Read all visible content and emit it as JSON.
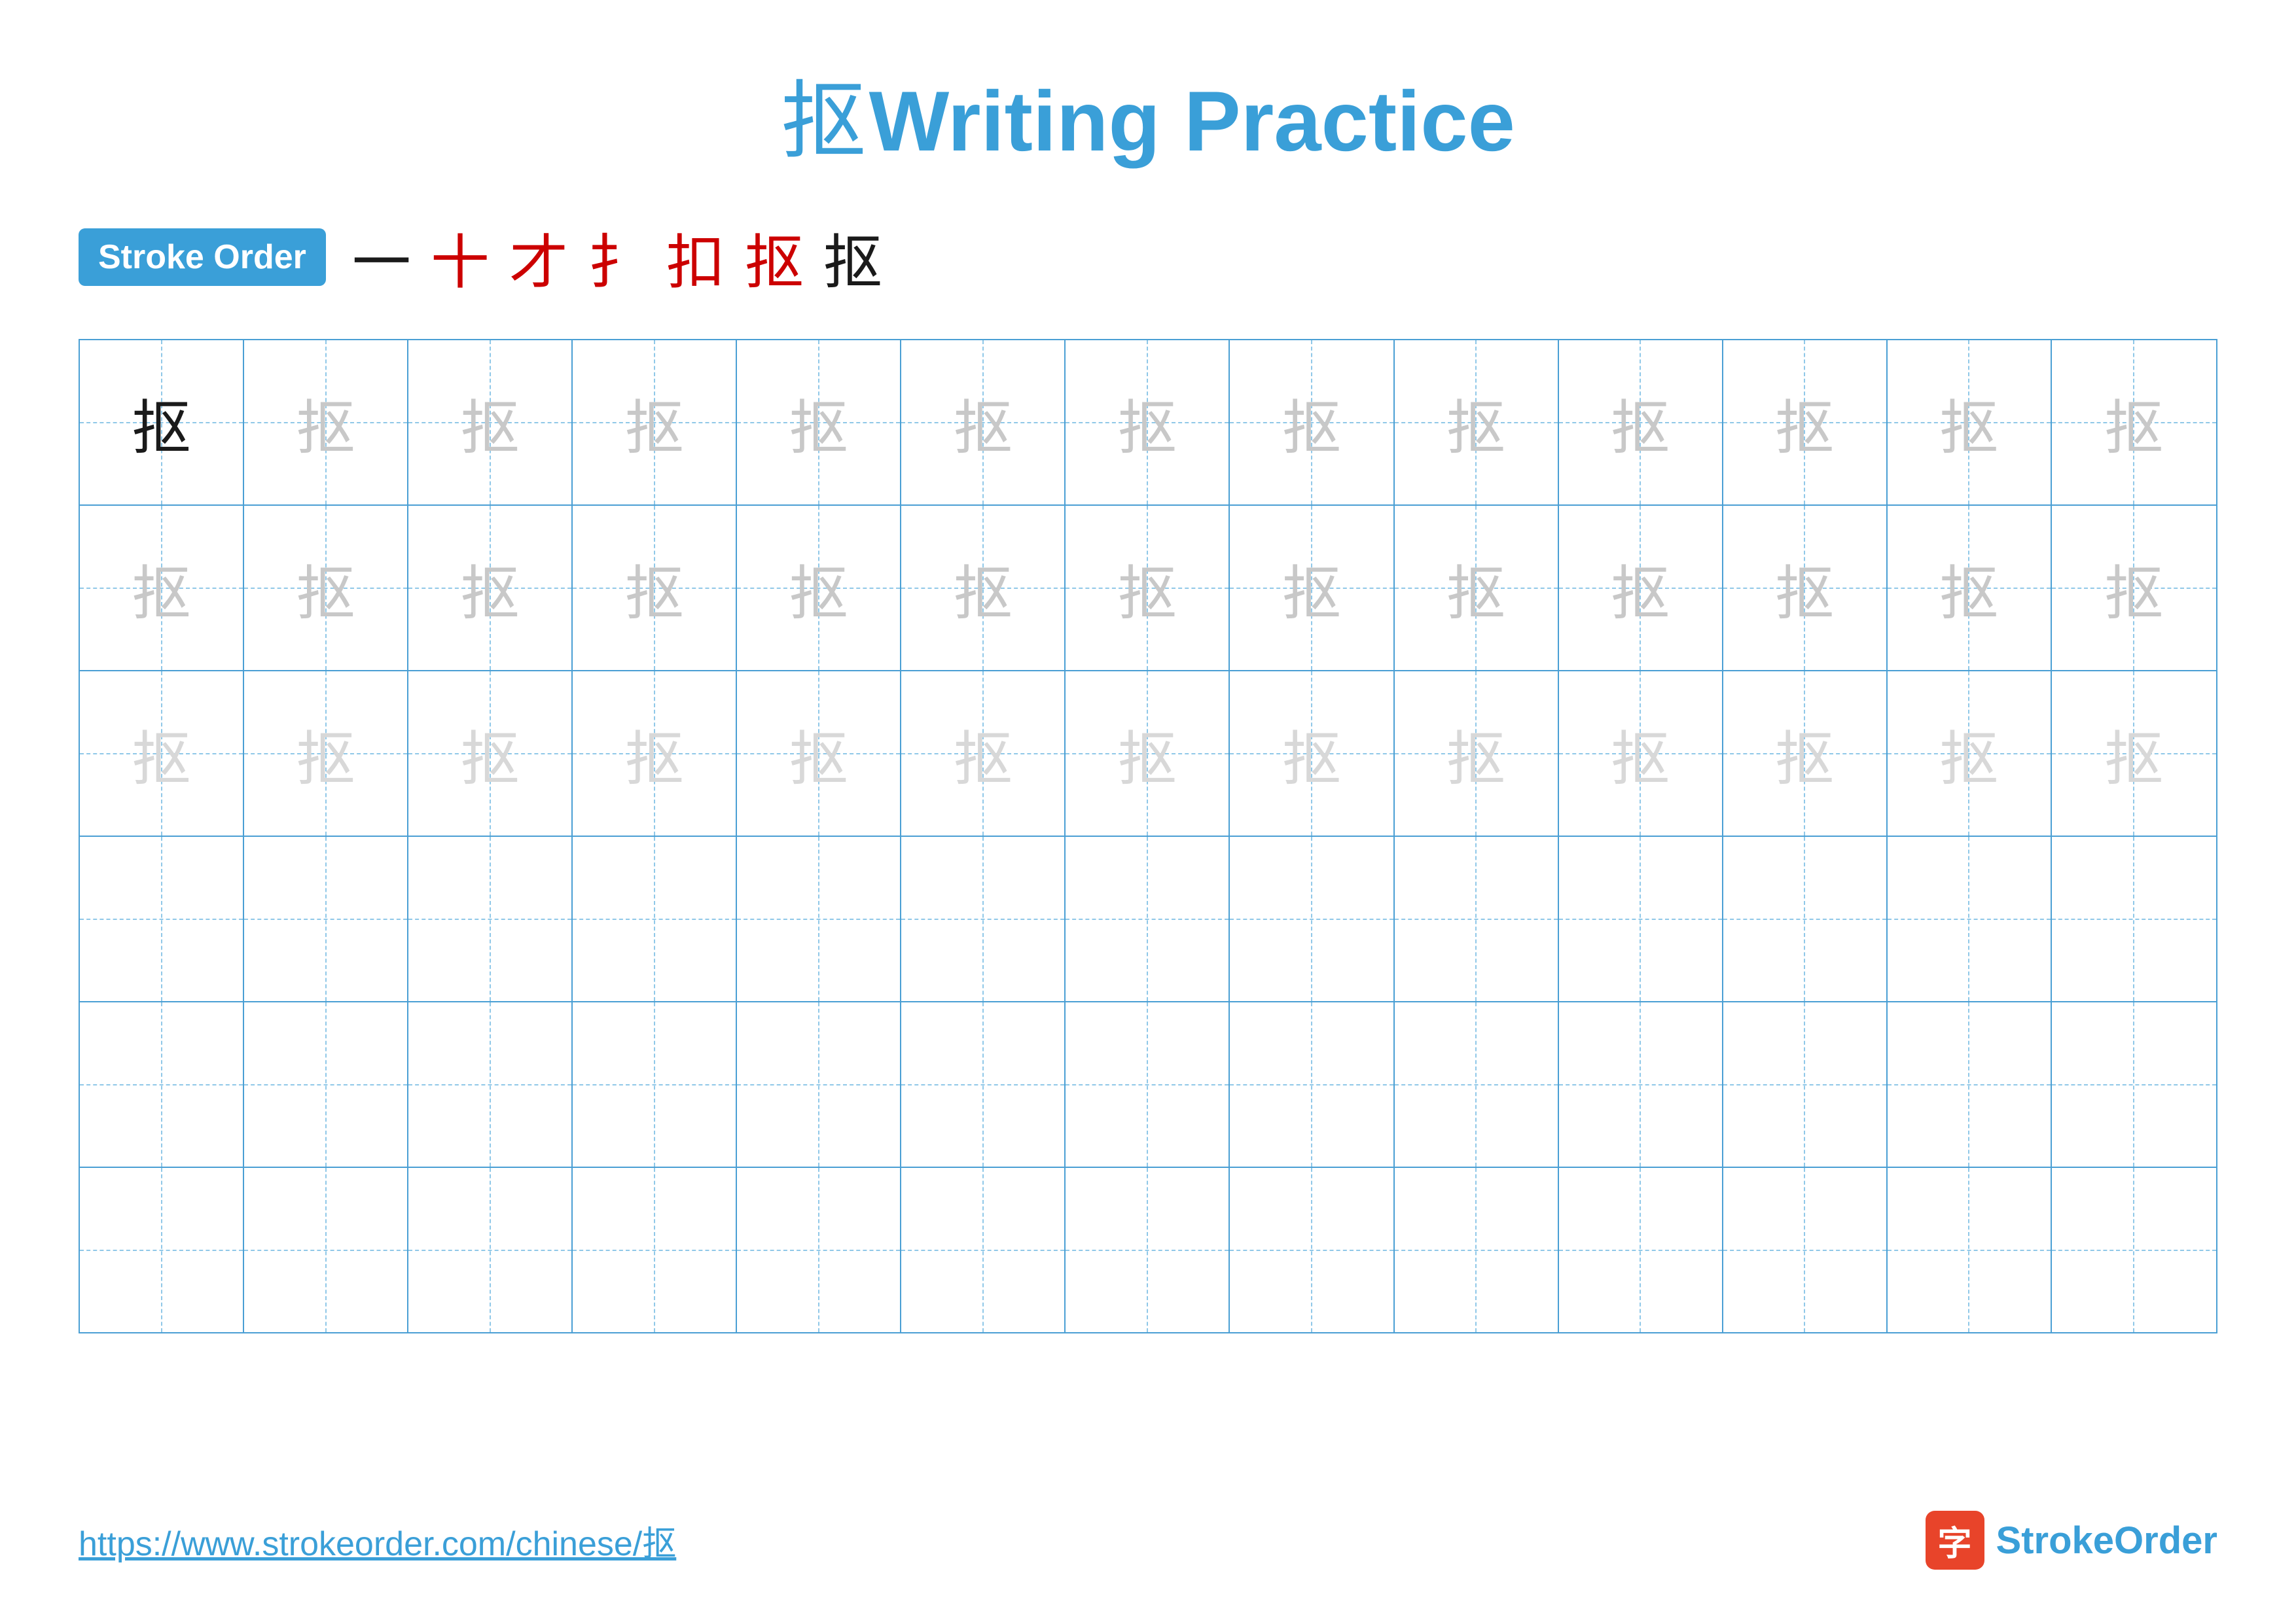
{
  "page": {
    "title": {
      "char": "抠",
      "text": "Writing Practice"
    },
    "stroke_order": {
      "badge_label": "Stroke Order",
      "strokes": [
        "一",
        "十",
        "才",
        "扌",
        "扣",
        "抠",
        "抠"
      ]
    },
    "grid": {
      "rows": 6,
      "cols": 13,
      "char": "抠",
      "row_styles": [
        "dark",
        "medium",
        "light",
        "empty",
        "empty",
        "empty"
      ]
    },
    "footer": {
      "url": "https://www.strokeorder.com/chinese/抠",
      "logo_char": "字",
      "logo_text_part1": "Stroke",
      "logo_text_part2": "Order"
    }
  }
}
